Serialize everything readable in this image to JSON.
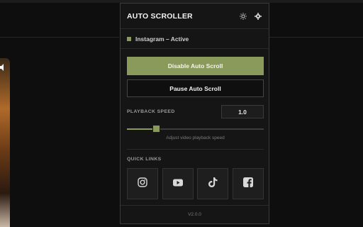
{
  "popup": {
    "title": "AUTO SCROLLER",
    "header_icons": [
      "sun-icon",
      "gear-icon"
    ],
    "status": {
      "text": "Instagram – Active",
      "dot_color": "#8a9a5b"
    },
    "buttons": {
      "primary": "Disable Auto Scroll",
      "secondary": "Pause Auto Scroll"
    },
    "speed": {
      "label": "PLAYBACK SPEED",
      "value": "1.0",
      "slider_fraction": 0.2,
      "hint": "Adjust video playback speed"
    },
    "quick_links": {
      "label": "QUICK LINKS",
      "items": [
        {
          "icon": "instagram-icon"
        },
        {
          "icon": "youtube-icon"
        },
        {
          "icon": "tiktok-icon"
        },
        {
          "icon": "facebook-icon"
        }
      ]
    },
    "footer": "V2.0.0"
  },
  "colors": {
    "accent": "#8a9a5b",
    "panel_bg": "#151515",
    "page_bg": "#0e0e0e"
  }
}
